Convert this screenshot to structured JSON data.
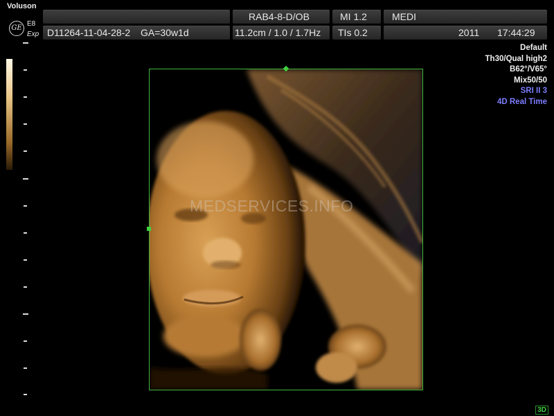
{
  "header": {
    "brand": "Voluson",
    "logo_text": "GE",
    "model": "E8",
    "mode_label": "Exp",
    "probe": "RAB4-8-D/OB",
    "mi": "MI 1.2",
    "institution": "MEDI",
    "patient_id": "D11264-11-04-28-2",
    "gestational_age": "GA=30w1d",
    "depth_params": "11.2cm / 1.0 / 1.7Hz",
    "tis": "TIs 0.2",
    "year": "2011",
    "time": "17:44:29"
  },
  "settings": {
    "preset": "Default",
    "quality": "Th30/Qual high2",
    "angles": "B62°/V65°",
    "mix": "Mix50/50",
    "sri": "SRI II 3",
    "realtime": "4D Real Time"
  },
  "watermark": "MEDSERVICES.INFO",
  "mode_badge": "3D",
  "colors": {
    "roi_box": "#3fb83f",
    "accent_blue": "#7c7cff",
    "render_tone": "#c98a3a"
  },
  "icons": {
    "logo": "ge-logo-icon"
  }
}
